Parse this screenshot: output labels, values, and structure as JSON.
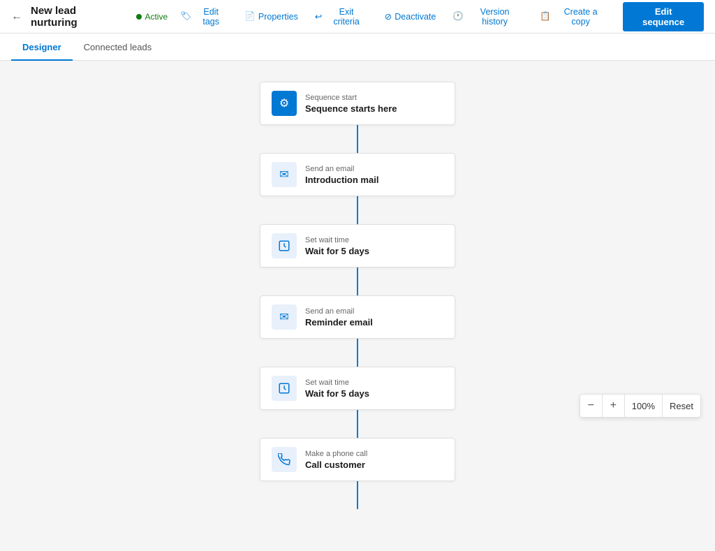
{
  "header": {
    "back_icon": "←",
    "title": "New lead nurturing",
    "status": "Active",
    "actions": [
      {
        "id": "edit-tags",
        "label": "Edit tags",
        "icon": "🏷"
      },
      {
        "id": "properties",
        "label": "Properties",
        "icon": "📄"
      },
      {
        "id": "exit-criteria",
        "label": "Exit criteria",
        "icon": "↩"
      },
      {
        "id": "deactivate",
        "label": "Deactivate",
        "icon": "⊘"
      },
      {
        "id": "version-history",
        "label": "Version history",
        "icon": "🕐"
      },
      {
        "id": "create-copy",
        "label": "Create a copy",
        "icon": "📋"
      }
    ],
    "edit_button": "Edit sequence"
  },
  "tabs": [
    {
      "id": "designer",
      "label": "Designer",
      "active": true
    },
    {
      "id": "connected-leads",
      "label": "Connected leads",
      "active": false
    }
  ],
  "nodes": [
    {
      "id": "start",
      "type": "start",
      "icon_type": "start",
      "icon": "⚙",
      "label": "Sequence start",
      "title": "Sequence starts here"
    },
    {
      "id": "email-1",
      "type": "email",
      "icon_type": "email",
      "icon": "✉",
      "label": "Send an email",
      "title": "Introduction mail"
    },
    {
      "id": "wait-1",
      "type": "wait",
      "icon_type": "wait",
      "icon": "⏳",
      "label": "Set wait time",
      "title": "Wait for 5 days"
    },
    {
      "id": "email-2",
      "type": "email",
      "icon_type": "email",
      "icon": "✉",
      "label": "Send an email",
      "title": "Reminder email"
    },
    {
      "id": "wait-2",
      "type": "wait",
      "icon_type": "wait",
      "icon": "⏳",
      "label": "Set wait time",
      "title": "Wait for 5 days"
    },
    {
      "id": "phone-1",
      "type": "phone",
      "icon_type": "phone",
      "icon": "📞",
      "label": "Make a phone call",
      "title": "Call customer"
    }
  ],
  "zoom": {
    "value": "100%",
    "reset_label": "Reset",
    "minus_icon": "−",
    "plus_icon": "+"
  }
}
